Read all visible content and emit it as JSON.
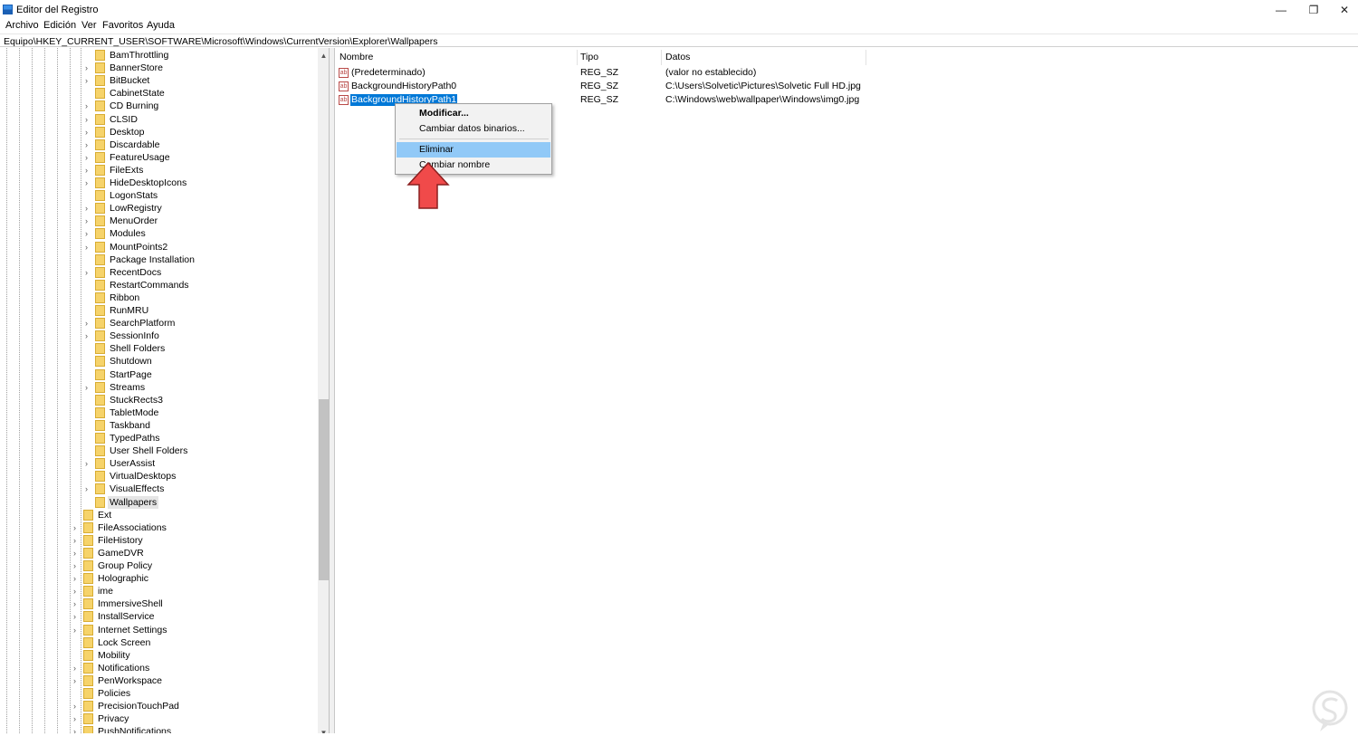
{
  "window": {
    "title": "Editor del Registro",
    "controls": {
      "minimize": "—",
      "maximize": "❐",
      "close": "✕"
    }
  },
  "menu": [
    "Archivo",
    "Edición",
    "Ver",
    "Favoritos",
    "Ayuda"
  ],
  "address": "Equipo\\HKEY_CURRENT_USER\\SOFTWARE\\Microsoft\\Windows\\CurrentVersion\\Explorer\\Wallpapers",
  "tree": {
    "explorer_children": [
      {
        "label": "BamThrottling",
        "expandable": false
      },
      {
        "label": "BannerStore",
        "expandable": true
      },
      {
        "label": "BitBucket",
        "expandable": true
      },
      {
        "label": "CabinetState",
        "expandable": false
      },
      {
        "label": "CD Burning",
        "expandable": true
      },
      {
        "label": "CLSID",
        "expandable": true
      },
      {
        "label": "Desktop",
        "expandable": true
      },
      {
        "label": "Discardable",
        "expandable": true
      },
      {
        "label": "FeatureUsage",
        "expandable": true
      },
      {
        "label": "FileExts",
        "expandable": true
      },
      {
        "label": "HideDesktopIcons",
        "expandable": true
      },
      {
        "label": "LogonStats",
        "expandable": false
      },
      {
        "label": "LowRegistry",
        "expandable": true
      },
      {
        "label": "MenuOrder",
        "expandable": true
      },
      {
        "label": "Modules",
        "expandable": true
      },
      {
        "label": "MountPoints2",
        "expandable": true
      },
      {
        "label": "Package Installation",
        "expandable": false
      },
      {
        "label": "RecentDocs",
        "expandable": true
      },
      {
        "label": "RestartCommands",
        "expandable": false
      },
      {
        "label": "Ribbon",
        "expandable": false
      },
      {
        "label": "RunMRU",
        "expandable": false
      },
      {
        "label": "SearchPlatform",
        "expandable": true
      },
      {
        "label": "SessionInfo",
        "expandable": true
      },
      {
        "label": "Shell Folders",
        "expandable": false
      },
      {
        "label": "Shutdown",
        "expandable": false
      },
      {
        "label": "StartPage",
        "expandable": false
      },
      {
        "label": "Streams",
        "expandable": true
      },
      {
        "label": "StuckRects3",
        "expandable": false
      },
      {
        "label": "TabletMode",
        "expandable": false
      },
      {
        "label": "Taskband",
        "expandable": false
      },
      {
        "label": "TypedPaths",
        "expandable": false
      },
      {
        "label": "User Shell Folders",
        "expandable": false
      },
      {
        "label": "UserAssist",
        "expandable": true
      },
      {
        "label": "VirtualDesktops",
        "expandable": false
      },
      {
        "label": "VisualEffects",
        "expandable": true
      },
      {
        "label": "Wallpapers",
        "expandable": false,
        "selected": true
      }
    ],
    "sibling_keys": [
      {
        "label": "Ext",
        "expandable": false
      },
      {
        "label": "FileAssociations",
        "expandable": true
      },
      {
        "label": "FileHistory",
        "expandable": true
      },
      {
        "label": "GameDVR",
        "expandable": true
      },
      {
        "label": "Group Policy",
        "expandable": true
      },
      {
        "label": "Holographic",
        "expandable": true
      },
      {
        "label": "ime",
        "expandable": true
      },
      {
        "label": "ImmersiveShell",
        "expandable": true
      },
      {
        "label": "InstallService",
        "expandable": true
      },
      {
        "label": "Internet Settings",
        "expandable": true
      },
      {
        "label": "Lock Screen",
        "expandable": false
      },
      {
        "label": "Mobility",
        "expandable": false
      },
      {
        "label": "Notifications",
        "expandable": true
      },
      {
        "label": "PenWorkspace",
        "expandable": true
      },
      {
        "label": "Policies",
        "expandable": false
      },
      {
        "label": "PrecisionTouchPad",
        "expandable": true
      },
      {
        "label": "Privacy",
        "expandable": true
      },
      {
        "label": "PushNotifications",
        "expandable": true
      }
    ]
  },
  "list": {
    "columns": [
      "Nombre",
      "Tipo",
      "Datos"
    ],
    "rows": [
      {
        "name": "(Predeterminado)",
        "type": "REG_SZ",
        "data": "(valor no establecido)",
        "icon_text": "ab"
      },
      {
        "name": "BackgroundHistoryPath0",
        "type": "REG_SZ",
        "data": "C:\\Users\\Solvetic\\Pictures\\Solvetic Full HD.jpg",
        "icon_text": "ab"
      },
      {
        "name": "BackgroundHistoryPath1",
        "type": "REG_SZ",
        "data": "C:\\Windows\\web\\wallpaper\\Windows\\img0.jpg",
        "icon_text": "ab",
        "selected": true
      }
    ]
  },
  "context_menu": {
    "items": [
      {
        "label": "Modificar...",
        "bold": true
      },
      {
        "label": "Cambiar datos binarios..."
      },
      {
        "label": "Eliminar",
        "highlighted": true
      },
      {
        "label": "Cambiar nombre"
      }
    ]
  },
  "colors": {
    "selection_blue": "#0078d7",
    "menu_highlight": "#91c9f7",
    "folder_yellow": "#f6d36a",
    "arrow_red": "#f04a4a"
  },
  "icons": {
    "app": "registry-editor-icon",
    "value": "string-value-icon",
    "folder": "folder-icon",
    "pointer": "red-up-arrow",
    "watermark": "solvetic-logo"
  }
}
